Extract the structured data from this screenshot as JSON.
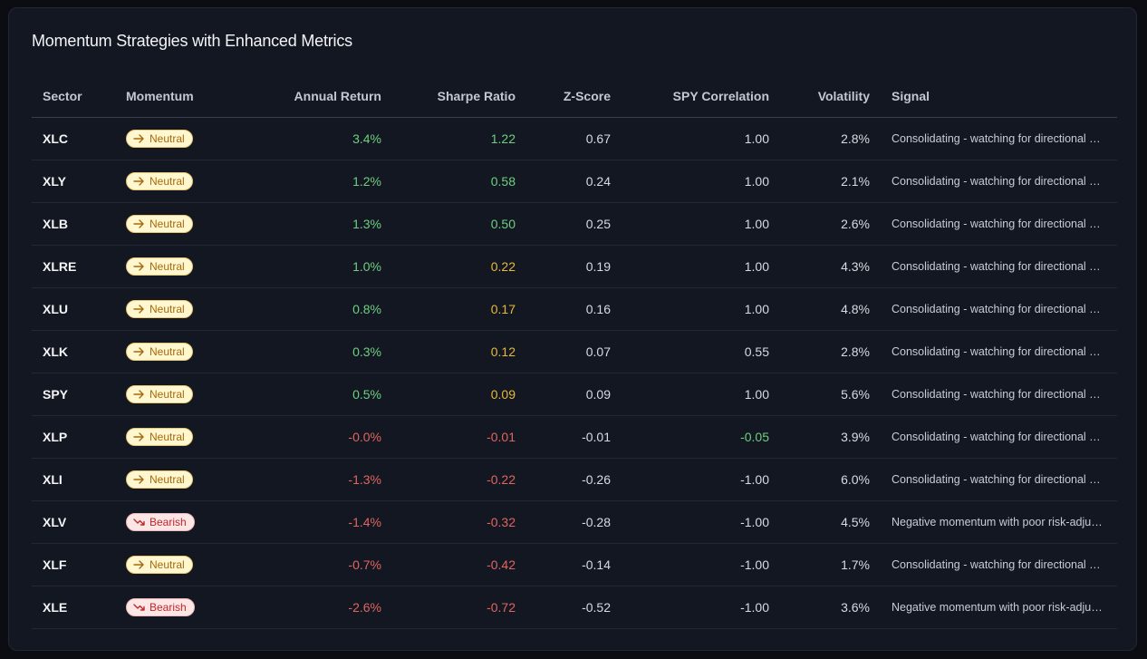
{
  "title": "Momentum Strategies with Enhanced Metrics",
  "columns": {
    "sector": "Sector",
    "momentum": "Momentum",
    "annual_return": "Annual Return",
    "sharpe": "Sharpe Ratio",
    "zscore": "Z-Score",
    "spy_corr": "SPY Correlation",
    "volatility": "Volatility",
    "signal": "Signal"
  },
  "colors": {
    "positive": "#6fcf7f",
    "negative": "#e0655f",
    "caution": "#e6b93c",
    "neutral_text": "#d7dae0"
  },
  "rows": [
    {
      "sector": "XLC",
      "momentum": "Neutral",
      "momentum_icon": "arrow-right-icon",
      "annual_return": "3.4%",
      "ret_tone": "pos",
      "sharpe": "1.22",
      "sharpe_tone": "pos",
      "zscore": "0.67",
      "spy_corr": "1.00",
      "corr_tone": "neu",
      "volatility": "2.8%",
      "signal": "Consolidating - watching for directional breakout"
    },
    {
      "sector": "XLY",
      "momentum": "Neutral",
      "momentum_icon": "arrow-right-icon",
      "annual_return": "1.2%",
      "ret_tone": "pos",
      "sharpe": "0.58",
      "sharpe_tone": "pos",
      "zscore": "0.24",
      "spy_corr": "1.00",
      "corr_tone": "neu",
      "volatility": "2.1%",
      "signal": "Consolidating - watching for directional breakout"
    },
    {
      "sector": "XLB",
      "momentum": "Neutral",
      "momentum_icon": "arrow-right-icon",
      "annual_return": "1.3%",
      "ret_tone": "pos",
      "sharpe": "0.50",
      "sharpe_tone": "pos",
      "zscore": "0.25",
      "spy_corr": "1.00",
      "corr_tone": "neu",
      "volatility": "2.6%",
      "signal": "Consolidating - watching for directional breakout"
    },
    {
      "sector": "XLRE",
      "momentum": "Neutral",
      "momentum_icon": "arrow-right-icon",
      "annual_return": "1.0%",
      "ret_tone": "pos",
      "sharpe": "0.22",
      "sharpe_tone": "mid",
      "zscore": "0.19",
      "spy_corr": "1.00",
      "corr_tone": "neu",
      "volatility": "4.3%",
      "signal": "Consolidating - watching for directional breakout"
    },
    {
      "sector": "XLU",
      "momentum": "Neutral",
      "momentum_icon": "arrow-right-icon",
      "annual_return": "0.8%",
      "ret_tone": "pos",
      "sharpe": "0.17",
      "sharpe_tone": "mid",
      "zscore": "0.16",
      "spy_corr": "1.00",
      "corr_tone": "neu",
      "volatility": "4.8%",
      "signal": "Consolidating - watching for directional breakout"
    },
    {
      "sector": "XLK",
      "momentum": "Neutral",
      "momentum_icon": "arrow-right-icon",
      "annual_return": "0.3%",
      "ret_tone": "pos",
      "sharpe": "0.12",
      "sharpe_tone": "mid",
      "zscore": "0.07",
      "spy_corr": "0.55",
      "corr_tone": "neu",
      "volatility": "2.8%",
      "signal": "Consolidating - watching for directional breakout"
    },
    {
      "sector": "SPY",
      "momentum": "Neutral",
      "momentum_icon": "arrow-right-icon",
      "annual_return": "0.5%",
      "ret_tone": "pos",
      "sharpe": "0.09",
      "sharpe_tone": "mid",
      "zscore": "0.09",
      "spy_corr": "1.00",
      "corr_tone": "neu",
      "volatility": "5.6%",
      "signal": "Consolidating - watching for directional breakout"
    },
    {
      "sector": "XLP",
      "momentum": "Neutral",
      "momentum_icon": "arrow-right-icon",
      "annual_return": "-0.0%",
      "ret_tone": "neg",
      "sharpe": "-0.01",
      "sharpe_tone": "neg",
      "zscore": "-0.01",
      "spy_corr": "-0.05",
      "corr_tone": "pos",
      "volatility": "3.9%",
      "signal": "Consolidating - watching for directional breakout"
    },
    {
      "sector": "XLI",
      "momentum": "Neutral",
      "momentum_icon": "arrow-right-icon",
      "annual_return": "-1.3%",
      "ret_tone": "neg",
      "sharpe": "-0.22",
      "sharpe_tone": "neg",
      "zscore": "-0.26",
      "spy_corr": "-1.00",
      "corr_tone": "neu",
      "volatility": "6.0%",
      "signal": "Consolidating - watching for directional breakout"
    },
    {
      "sector": "XLV",
      "momentum": "Bearish",
      "momentum_icon": "trend-down-icon",
      "annual_return": "-1.4%",
      "ret_tone": "neg",
      "sharpe": "-0.32",
      "sharpe_tone": "neg",
      "zscore": "-0.28",
      "spy_corr": "-1.00",
      "corr_tone": "neu",
      "volatility": "4.5%",
      "signal": "Negative momentum with poor risk-adjusted returns"
    },
    {
      "sector": "XLF",
      "momentum": "Neutral",
      "momentum_icon": "arrow-right-icon",
      "annual_return": "-0.7%",
      "ret_tone": "neg",
      "sharpe": "-0.42",
      "sharpe_tone": "neg",
      "zscore": "-0.14",
      "spy_corr": "-1.00",
      "corr_tone": "neu",
      "volatility": "1.7%",
      "signal": "Consolidating - watching for directional breakout"
    },
    {
      "sector": "XLE",
      "momentum": "Bearish",
      "momentum_icon": "trend-down-icon",
      "annual_return": "-2.6%",
      "ret_tone": "neg",
      "sharpe": "-0.72",
      "sharpe_tone": "neg",
      "zscore": "-0.52",
      "spy_corr": "-1.00",
      "corr_tone": "neu",
      "volatility": "3.6%",
      "signal": "Negative momentum with poor risk-adjusted returns"
    }
  ]
}
